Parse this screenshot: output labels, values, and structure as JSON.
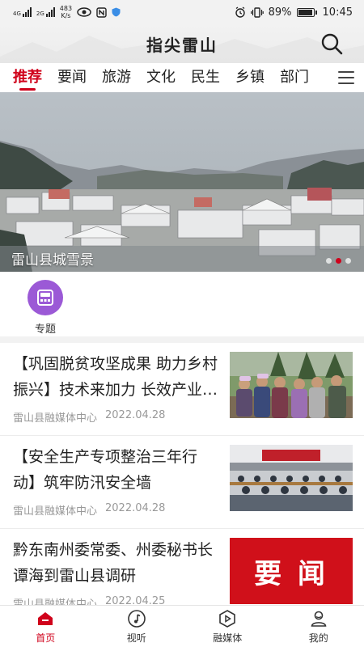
{
  "status_bar": {
    "network_1": "4G",
    "network_2": "2G",
    "speed_value": "483",
    "speed_unit": "K/s",
    "battery": "89%",
    "time": "10:45"
  },
  "header": {
    "title": "指尖雷山",
    "search_icon": "search-icon"
  },
  "tabs": [
    {
      "label": "推荐",
      "active": true
    },
    {
      "label": "要闻"
    },
    {
      "label": "旅游"
    },
    {
      "label": "文化"
    },
    {
      "label": "民生"
    },
    {
      "label": "乡镇"
    },
    {
      "label": "部门"
    }
  ],
  "banner": {
    "caption": "雷山县城雪景",
    "slide_count": 3,
    "active_slide": 2
  },
  "quick_links": [
    {
      "label": "专题",
      "icon": "calculator-icon",
      "color": "#9b59d6"
    }
  ],
  "news": [
    {
      "title": "【巩固脱贫攻坚成果 助力乡村振兴】技术来加力 长效产业来支撑",
      "source": "雷山县融媒体中心",
      "date": "2022.04.28",
      "thumb": "villagers-photo"
    },
    {
      "title": "【安全生产专项整治三年行动】筑牢防汛安全墙",
      "source": "雷山县融媒体中心",
      "date": "2022.04.28",
      "thumb": "meeting-photo"
    },
    {
      "title": "黔东南州委常委、州委秘书长谭海到雷山县调研",
      "source": "雷山县融媒体中心",
      "date": "2022.04.25",
      "thumb_text": "要 闻",
      "thumb_color": "#d0101a"
    }
  ],
  "bottom_nav": [
    {
      "label": "首页",
      "icon": "home-icon",
      "active": true
    },
    {
      "label": "视听",
      "icon": "music-icon"
    },
    {
      "label": "融媒体",
      "icon": "play-icon"
    },
    {
      "label": "我的",
      "icon": "user-icon"
    }
  ],
  "colors": {
    "accent": "#d0021b"
  }
}
